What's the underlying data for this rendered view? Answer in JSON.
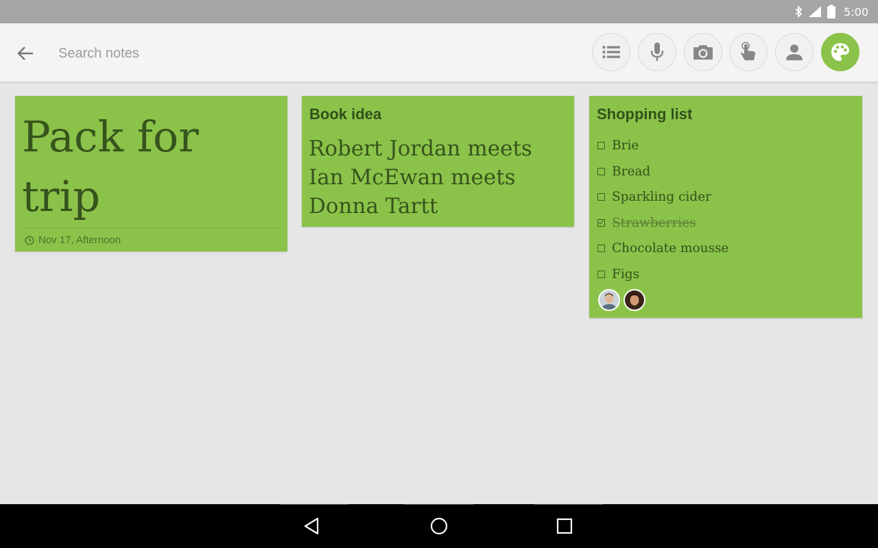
{
  "status_bar": {
    "time": "5:00",
    "icons": [
      "bluetooth-icon",
      "cell-signal-icon",
      "battery-icon"
    ]
  },
  "toolbar": {
    "back_icon": "arrow-back-icon",
    "search": {
      "placeholder": "Search notes",
      "value": ""
    },
    "buttons": [
      {
        "name": "list-button",
        "icon": "list-icon",
        "active": false
      },
      {
        "name": "voice-button",
        "icon": "microphone-icon",
        "active": false
      },
      {
        "name": "camera-button",
        "icon": "camera-icon",
        "active": false
      },
      {
        "name": "drawing-button",
        "icon": "touch-hand-icon",
        "active": false
      },
      {
        "name": "collaborator-button",
        "icon": "person-icon",
        "active": false
      },
      {
        "name": "color-button",
        "icon": "palette-icon",
        "active": true
      }
    ]
  },
  "colors": {
    "note_green": "#8bc34a",
    "note_text": "#33501a",
    "toolbar_bg": "#f4f4f4",
    "page_bg": "#e6e6e6",
    "status_bar_bg": "#a5a5a5"
  },
  "notes": {
    "pack": {
      "body": "Pack for trip",
      "reminder": "Nov 17, Afternoon",
      "reminder_icon": "clock-icon"
    },
    "book": {
      "title": "Book idea",
      "body": "Robert Jordan meets Ian McEwan meets Donna Tartt"
    },
    "shopping": {
      "title": "Shopping list",
      "items": [
        {
          "text": "Brie",
          "checked": false
        },
        {
          "text": "Bread",
          "checked": false
        },
        {
          "text": "Sparkling cider",
          "checked": false
        },
        {
          "text": "Strawberries",
          "checked": true
        },
        {
          "text": "Chocolate mousse",
          "checked": false
        },
        {
          "text": "Figs",
          "checked": false
        }
      ],
      "collaborators": [
        "avatar-man",
        "avatar-woman"
      ]
    }
  },
  "nav_bar": {
    "buttons": [
      "back-triangle-icon",
      "home-circle-icon",
      "recents-square-icon"
    ]
  }
}
